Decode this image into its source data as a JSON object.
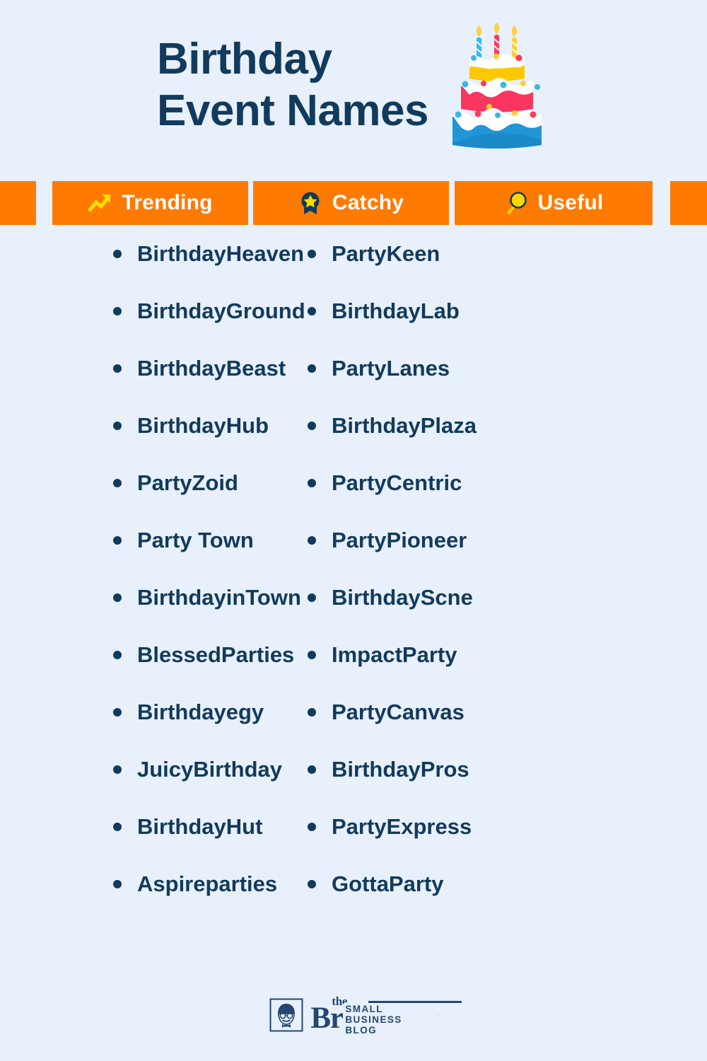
{
  "page": {
    "background_color": "#e7f0fb",
    "text_color": "#123a5c",
    "accent_color": "#ff7a00"
  },
  "header": {
    "title": "Birthday\nEvent Names",
    "illustration": "birthday-cake-icon"
  },
  "tags": [
    {
      "label": "Trending",
      "icon": "trending-up-icon"
    },
    {
      "label": "Catchy",
      "icon": "star-badge-icon"
    },
    {
      "label": "Useful",
      "icon": "magnifier-icon"
    }
  ],
  "names": {
    "left_column": [
      "BirthdayHeaven",
      "BirthdayGround",
      "BirthdayBeast",
      "BirthdayHub",
      "PartyZoid",
      "Party Town",
      "BirthdayinTown",
      "BlessedParties",
      "Birthdayegy",
      "JuicyBirthday",
      "BirthdayHut",
      "Aspireparties"
    ],
    "right_column": [
      "PartyKeen",
      "BirthdayLab",
      "PartyLanes",
      "BirthdayPlaza",
      "PartyCentric",
      "PartyPioneer",
      "BirthdayScne",
      "ImpactParty",
      "PartyCanvas",
      "BirthdayPros",
      "PartyExpress",
      "GottaParty"
    ]
  },
  "footer": {
    "logo_the": "the",
    "logo_name": "BrandBoy",
    "logo_tagline": "SMALL BUSINESS BLOG",
    "logo_mark": "boy-face-icon"
  }
}
